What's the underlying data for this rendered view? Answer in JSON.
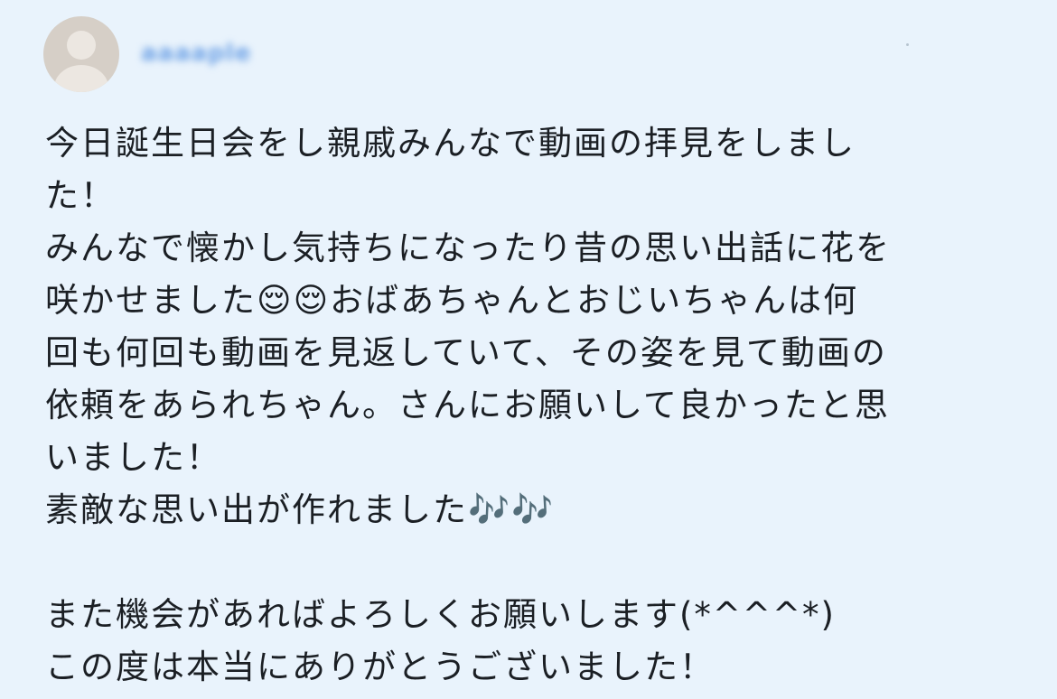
{
  "review": {
    "username": "aaaaple",
    "lines": [
      "今日誕生日会をし親戚みんなで動画の拝見をしまし",
      "た！",
      "みんなで懐かし気持ちになったり昔の思い出話に花を",
      "咲かせました😌😌おばあちゃんとおじいちゃんは何",
      "回も何回も動画を見返していて、その姿を見て動画の",
      "依頼をあられちゃん。さんにお願いして良かったと思",
      "いました！",
      "素敵な思い出が作れました🎶🎶",
      "",
      "また機会があればよろしくお願いします(*^^^*)",
      "この度は本当にありがとうございました！"
    ]
  }
}
